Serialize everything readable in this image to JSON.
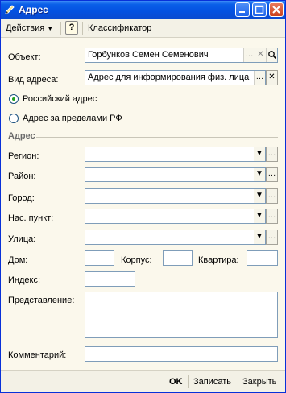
{
  "window": {
    "title": "Адрес"
  },
  "toolbar": {
    "actions_label": "Действия",
    "help_label": "?",
    "classifier_label": "Классификатор"
  },
  "form": {
    "object": {
      "label": "Объект:",
      "value": "Горбунков Семен Семенович"
    },
    "address_type": {
      "label": "Вид адреса:",
      "value": "Адрес для информирования физ. лица"
    },
    "radio_russian": {
      "label": "Российский адрес",
      "checked": true
    },
    "radio_foreign": {
      "label": "Адрес за пределами РФ",
      "checked": false
    },
    "section_title": "Адрес",
    "region_label": "Регион:",
    "district_label": "Район:",
    "city_label": "Город:",
    "locality_label": "Нас. пункт:",
    "street_label": "Улица:",
    "house_label": "Дом:",
    "building_label": "Корпус:",
    "apartment_label": "Квартира:",
    "index_label": "Индекс:",
    "presentation_label": "Представление:",
    "comment_label": "Комментарий:"
  },
  "footer": {
    "ok_label": "OK",
    "save_label": "Записать",
    "close_label": "Закрыть"
  },
  "icons": {
    "dropdown": "triangle-down-icon",
    "select": "ellipsis-icon",
    "clear": "x-icon",
    "open": "magnifier-icon"
  },
  "colors": {
    "titlebar": "#0451e1",
    "window_bg": "#fbf8ec",
    "field_border": "#7f9db9"
  }
}
